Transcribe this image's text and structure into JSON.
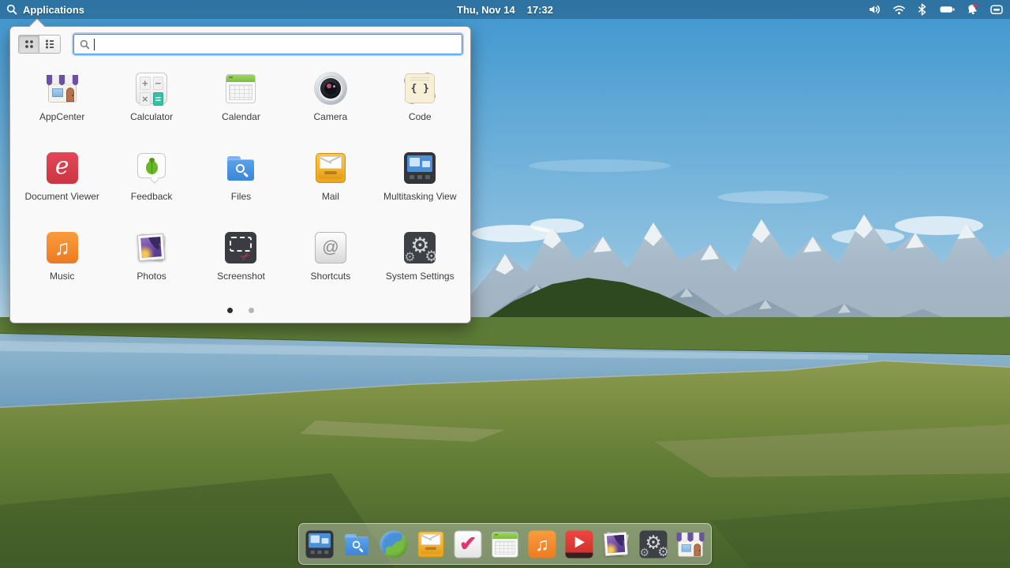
{
  "panel": {
    "applications_label": "Applications",
    "clock_date": "Thu, Nov 14",
    "clock_time": "17:32",
    "indicators": [
      "volume",
      "wifi",
      "bluetooth",
      "battery",
      "notifications",
      "session"
    ]
  },
  "launcher": {
    "search_placeholder": "",
    "search_value": "",
    "view_toggle": {
      "active": "grid",
      "options": [
        "grid",
        "list"
      ]
    },
    "apps": [
      {
        "label": "AppCenter"
      },
      {
        "label": "Calculator"
      },
      {
        "label": "Calendar"
      },
      {
        "label": "Camera"
      },
      {
        "label": "Code"
      },
      {
        "label": "Document Viewer"
      },
      {
        "label": "Feedback"
      },
      {
        "label": "Files"
      },
      {
        "label": "Mail"
      },
      {
        "label": "Multitasking View"
      },
      {
        "label": "Music"
      },
      {
        "label": "Photos"
      },
      {
        "label": "Screenshot"
      },
      {
        "label": "Shortcuts"
      },
      {
        "label": "System Settings"
      }
    ],
    "pagination": {
      "pages": 2,
      "active_page": 1
    }
  },
  "dock": {
    "items": [
      "multitasking-view",
      "files",
      "web-browser",
      "mail",
      "tasks",
      "calendar",
      "music",
      "videos",
      "photos",
      "system-settings",
      "appcenter"
    ]
  },
  "colors": {
    "accent": "#3689e6",
    "panel_text": "#ffffff",
    "app_label_text": "#3d3d3d",
    "notification_badge": "#e0354f"
  }
}
